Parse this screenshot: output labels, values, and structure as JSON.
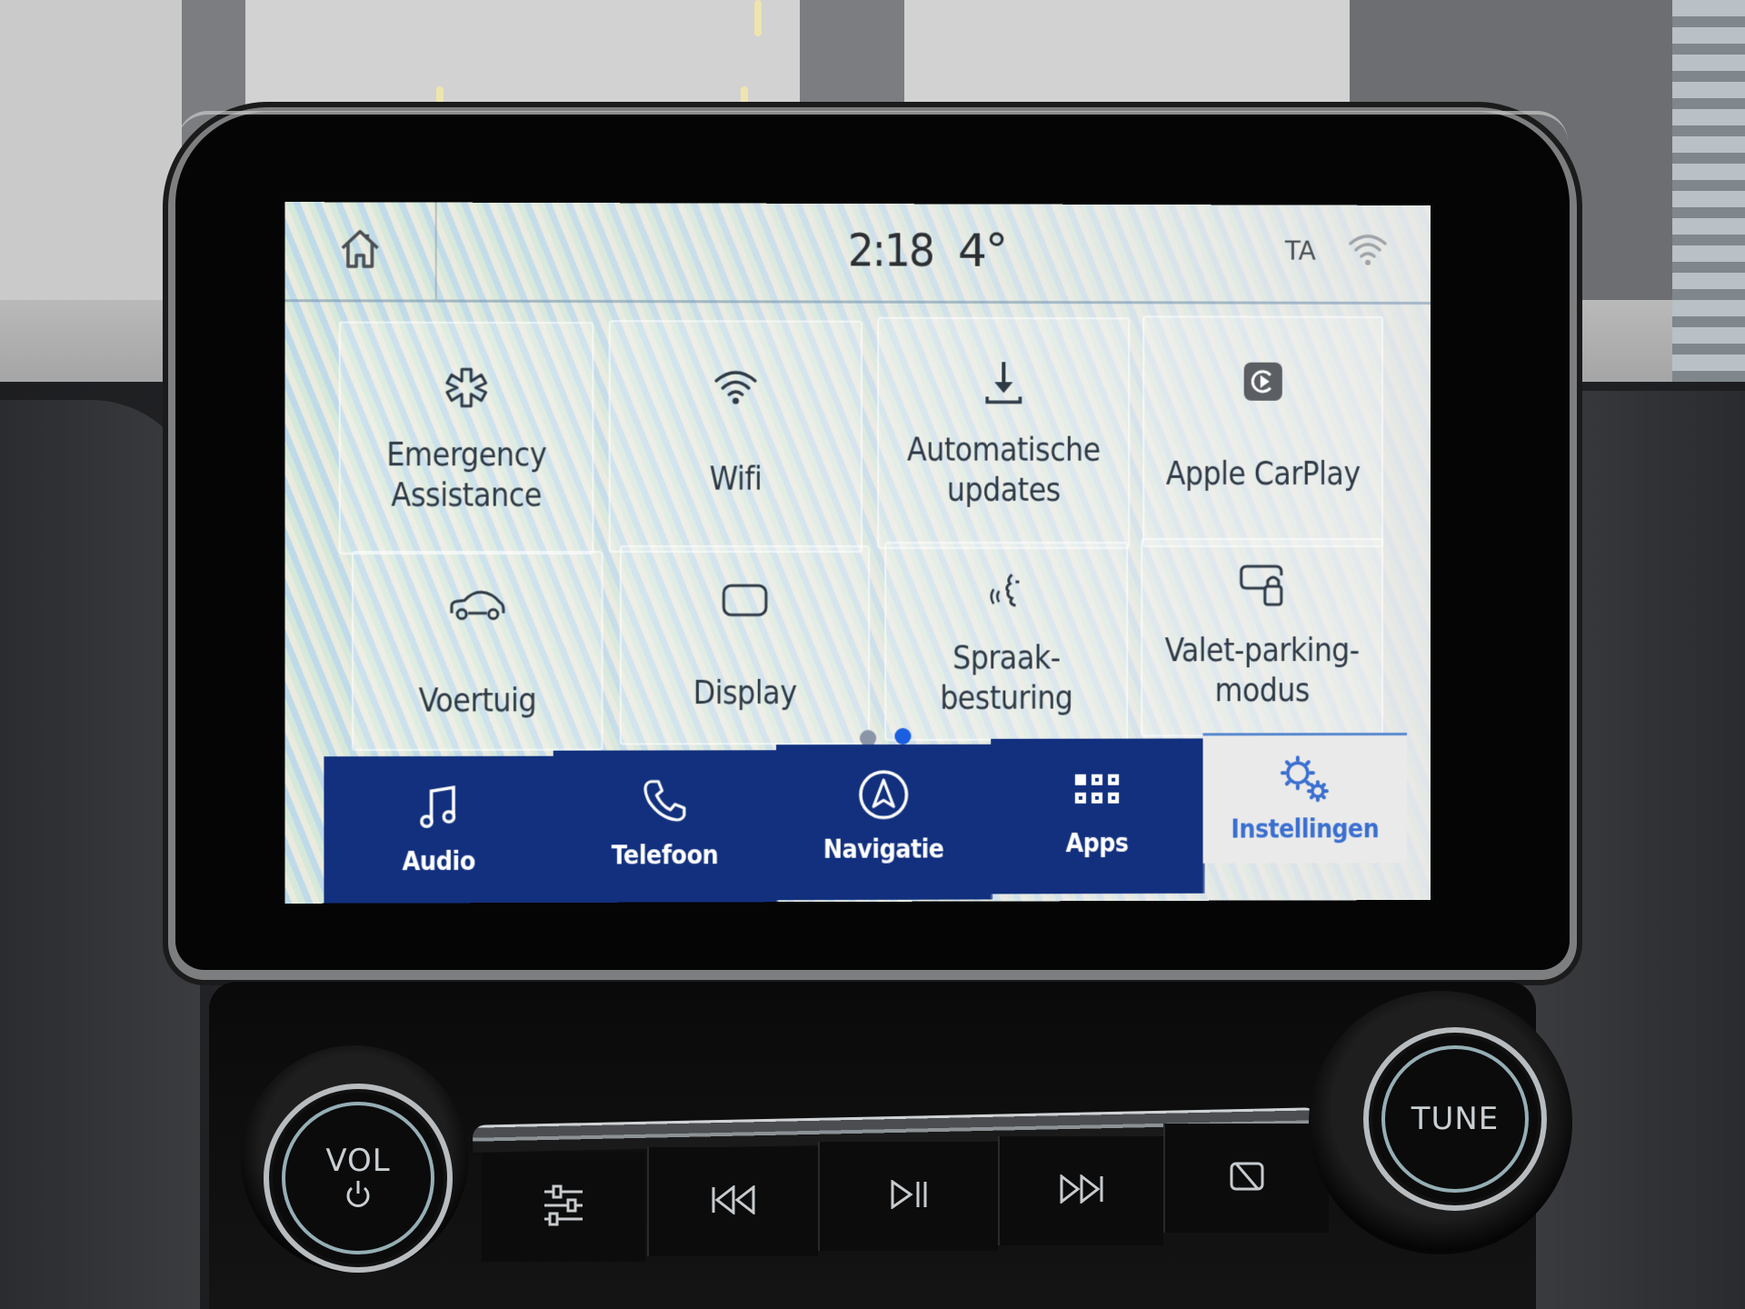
{
  "status_bar": {
    "home_icon": "home-icon",
    "time": "2:18",
    "temperature": "4°",
    "traffic_announcement": "TA",
    "wifi_icon": "wifi-signal-icon"
  },
  "settings_tiles": [
    {
      "label_line1": "Emergency",
      "label_line2": "Assistance",
      "icon": "emergency-asterisk-icon"
    },
    {
      "label_line1": "Wifi",
      "label_line2": "",
      "icon": "wifi-icon"
    },
    {
      "label_line1": "Automatische",
      "label_line2": "updates",
      "icon": "download-icon"
    },
    {
      "label_line1": "Apple CarPlay",
      "label_line2": "",
      "icon": "carplay-icon"
    },
    {
      "label_line1": "Voertuig",
      "label_line2": "",
      "icon": "car-icon"
    },
    {
      "label_line1": "Display",
      "label_line2": "",
      "icon": "display-icon"
    },
    {
      "label_line1": "Spraak-",
      "label_line2": "besturing",
      "icon": "voice-control-icon"
    },
    {
      "label_line1": "Valet-parking-",
      "label_line2": "modus",
      "icon": "valet-lock-icon"
    }
  ],
  "pagination": {
    "total_pages": 2,
    "current_page": 2
  },
  "bottom_nav": [
    {
      "label": "Audio",
      "icon": "music-note-icon",
      "active": false
    },
    {
      "label": "Telefoon",
      "icon": "phone-icon",
      "active": false
    },
    {
      "label": "Navigatie",
      "icon": "navigation-arrow-icon",
      "active": false
    },
    {
      "label": "Apps",
      "icon": "apps-grid-icon",
      "active": false
    },
    {
      "label": "Instellingen",
      "icon": "settings-gears-icon",
      "active": true
    }
  ],
  "hardware_controls": {
    "volume_knob_label": "VOL",
    "tune_knob_label": "TUNE",
    "buttons": [
      "equalizer-icon",
      "previous-track-icon",
      "play-pause-icon",
      "next-track-icon",
      "screen-off-icon"
    ]
  },
  "colors": {
    "nav_background": "#12307e",
    "active_accent": "#3a6fd0",
    "page_dot_active": "#1a5fe0",
    "page_dot_inactive": "#8a95a8",
    "tile_text": "#2e3a46"
  }
}
